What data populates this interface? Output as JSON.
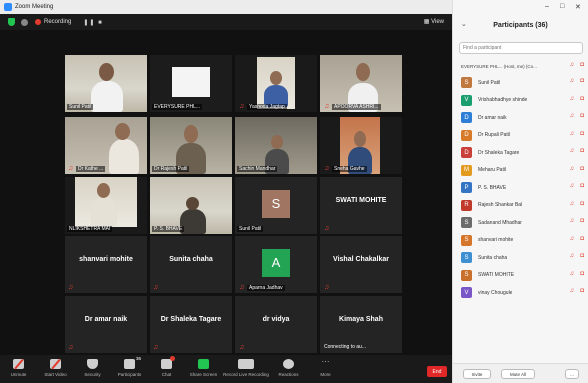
{
  "window": {
    "title": "Zoom Meeting"
  },
  "topbar": {
    "recording": "Recording",
    "view": "View"
  },
  "tiles": [
    {
      "name": "Sunil Patil"
    },
    {
      "name": "EVERYSURE PHL..."
    },
    {
      "name": "Yashoda Jagtap"
    },
    {
      "name": "APOORVA ASHRI..."
    },
    {
      "name": "Dr Kathe ..."
    },
    {
      "name": "Dr Rajesh Patil"
    },
    {
      "name": "Sachin Mandhar"
    },
    {
      "name": "Sneha Gavhe"
    },
    {
      "name": "NLIKSHETRA MAI"
    },
    {
      "name": "P. S. BHAVE"
    },
    {
      "name": "Sunil Patil",
      "initial": "S"
    },
    {
      "name": "SWATI MOHITE"
    },
    {
      "name": "shanvari mohite"
    },
    {
      "name": "Sunita chaha"
    },
    {
      "name": "Aparna Jadhav",
      "initial": "A"
    },
    {
      "name": "Vishal Chakalkar"
    },
    {
      "name": "Dr amar naik"
    },
    {
      "name": "Dr Shaleka Tagare"
    },
    {
      "name": "dr vidya"
    },
    {
      "name": "Kimaya Shah"
    }
  ],
  "tile_status": {
    "connecting": "Connecting to au..."
  },
  "toolbar": {
    "items": [
      {
        "label": "Unmute"
      },
      {
        "label": "Start Video"
      },
      {
        "label": "Security"
      },
      {
        "label": "Participants",
        "count": "36"
      },
      {
        "label": "Chat"
      },
      {
        "label": "Share Screen"
      },
      {
        "label": "Record Live Recording"
      },
      {
        "label": "Reactions"
      },
      {
        "label": "More"
      }
    ],
    "end": "End"
  },
  "panel": {
    "title": "Participants (36)",
    "search_placeholder": "Find a participant",
    "first_row": "EVERYSURE PHL... (Host, me) (Co...",
    "participants": [
      {
        "name": "Sunil Patil",
        "initial": "S",
        "color": "#c1783f"
      },
      {
        "name": "Vrishabhadhye shinde",
        "initial": "V",
        "color": "#1a9e6e"
      },
      {
        "name": "Dr amar naik",
        "initial": "D",
        "color": "#2d7fd6"
      },
      {
        "name": "Dr Rupali Patil",
        "initial": "D",
        "color": "#d77a2a"
      },
      {
        "name": "Dr Shaleka Tagare",
        "initial": "D",
        "color": "#c9403a"
      },
      {
        "name": "Meharu Patil",
        "initial": "M",
        "color": "#e29a1f"
      },
      {
        "name": "P. S. BHAVE",
        "initial": "P",
        "color": "#3574c4"
      },
      {
        "name": "Rajesh Shankar Bal",
        "initial": "R",
        "color": "#c0392b"
      },
      {
        "name": "Sadanand Mhadhar",
        "initial": "S",
        "color": "#6b6b6b"
      },
      {
        "name": "shanvari mohite",
        "initial": "S",
        "color": "#d6762a"
      },
      {
        "name": "Sunita chaha",
        "initial": "S",
        "color": "#3c8fd1"
      },
      {
        "name": "SWATI MOHITE",
        "initial": "S",
        "color": "#c8702c"
      },
      {
        "name": "vinay Chougule",
        "initial": "V",
        "color": "#7a57c7"
      }
    ],
    "invite": "Invite",
    "mute_all": "Mute All",
    "more": "..."
  }
}
